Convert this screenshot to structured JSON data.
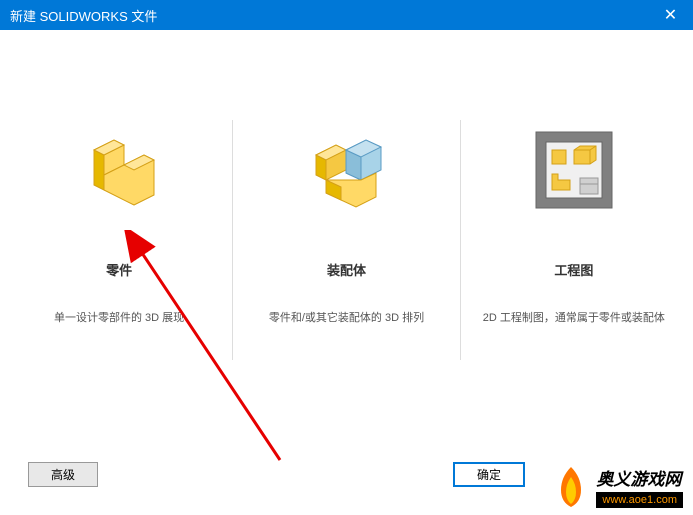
{
  "titlebar": {
    "title": "新建 SOLIDWORKS 文件"
  },
  "options": {
    "part": {
      "title": "零件",
      "desc": "单一设计零部件的 3D 展现"
    },
    "assembly": {
      "title": "装配体",
      "desc": "零件和/或其它装配体的 3D 排列"
    },
    "drawing": {
      "title": "工程图",
      "desc": "2D 工程制图，通常属于零件或装配体"
    }
  },
  "buttons": {
    "advanced": "高级",
    "ok": "确定"
  },
  "watermark": {
    "title": "奥义游戏网",
    "url": "www.aoe1.com"
  }
}
